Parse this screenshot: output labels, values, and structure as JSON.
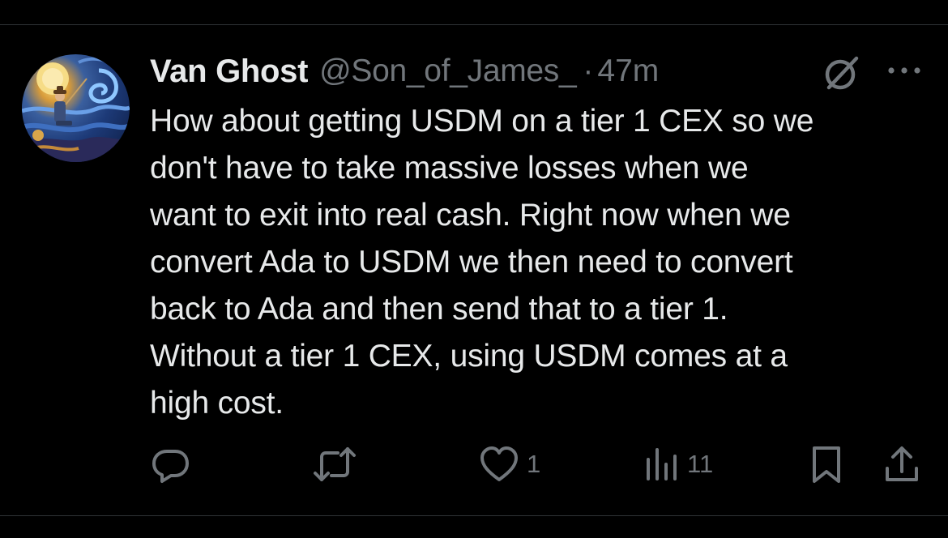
{
  "tweet": {
    "author_name": "Van Ghost",
    "handle": "@Son_of_James_",
    "separator": "·",
    "time": "47m",
    "text_lines": [
      "How about getting USDM on a tier 1 CEX so we",
      "don't have to take massive losses when we",
      "want to exit into real cash. Right now when we",
      "convert Ada to USDM we then need to convert",
      "back to Ada and then send that to a tier 1.",
      "Without a tier 1 CEX, using USDM comes at a",
      "high cost."
    ]
  },
  "actions": {
    "reply_icon": "reply-icon",
    "retweet_icon": "retweet-icon",
    "like_icon": "heart-icon",
    "like_count": "1",
    "views_icon": "views-icon",
    "views_count": "11",
    "bookmark_icon": "bookmark-icon",
    "share_icon": "share-icon"
  },
  "colors": {
    "background": "#000000",
    "text_primary": "#e7e9ea",
    "text_secondary": "#71767b",
    "divider": "#2f3336"
  }
}
